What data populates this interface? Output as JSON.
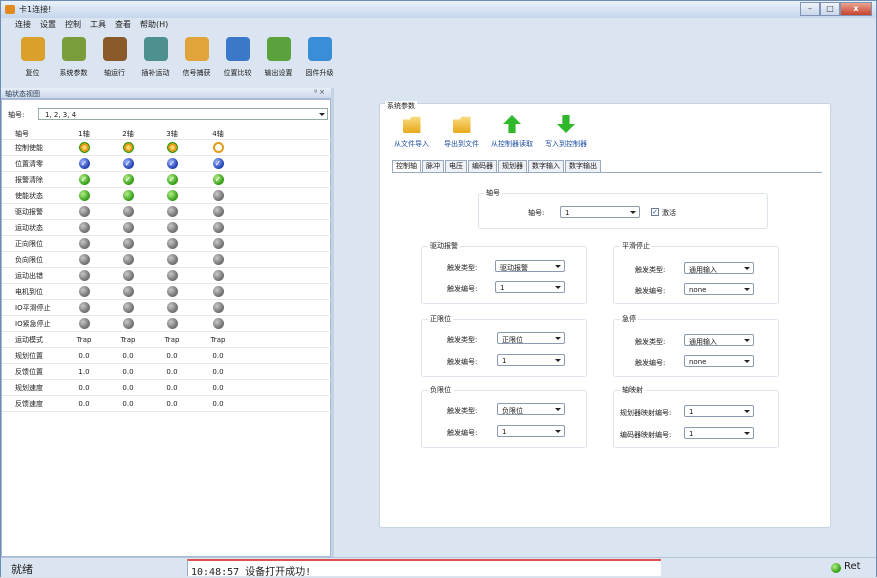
{
  "window": {
    "title": "卡1连接!",
    "buttons": {
      "minimize": "–",
      "maximize": "□",
      "close": "x"
    }
  },
  "menu": [
    "连接",
    "设置",
    "控制",
    "工具",
    "查看",
    "帮助(H)"
  ],
  "toolbar": [
    {
      "label": "复位",
      "icon": "reset-icon",
      "color": "#d9a12a"
    },
    {
      "label": "系统参数",
      "icon": "params-icon",
      "color": "#7a9c3b"
    },
    {
      "label": "轴运行",
      "icon": "wheel-icon",
      "color": "#8a5a2b"
    },
    {
      "label": "插补运动",
      "icon": "interp-icon",
      "color": "#4e8f8f"
    },
    {
      "label": "信号捕获",
      "icon": "map-pin-icon",
      "color": "#e0a43a"
    },
    {
      "label": "位置比较",
      "icon": "gear-globe-icon",
      "color": "#3c78c8"
    },
    {
      "label": "输出设置",
      "icon": "output-icon",
      "color": "#5aa23c"
    },
    {
      "label": "固件升级",
      "icon": "firmware-icon",
      "color": "#3a8ed8"
    }
  ],
  "left_panel": {
    "title": "轴状态视图",
    "header_buttons": "ᵍ ×",
    "axis_label": "轴号:",
    "axis_value": "1, 2, 3, 4",
    "columns": [
      "轴号",
      "1轴",
      "2轴",
      "3轴",
      "4轴"
    ],
    "led_rows": [
      {
        "label": "控制使能",
        "states": [
          "orange",
          "orange",
          "orange",
          "ring"
        ]
      },
      {
        "label": "位置清零",
        "states": [
          "blue",
          "blue",
          "blue",
          "blue"
        ]
      },
      {
        "label": "报警清除",
        "states": [
          "green-check",
          "green-check",
          "green-check",
          "green-check"
        ]
      },
      {
        "label": "使能状态",
        "states": [
          "green",
          "green",
          "green",
          "gray"
        ]
      },
      {
        "label": "驱动报警",
        "states": [
          "gray",
          "gray",
          "gray",
          "gray"
        ]
      },
      {
        "label": "运动状态",
        "states": [
          "gray",
          "gray",
          "gray",
          "gray"
        ]
      },
      {
        "label": "正向限位",
        "states": [
          "gray",
          "gray",
          "gray",
          "gray"
        ]
      },
      {
        "label": "负向限位",
        "states": [
          "gray",
          "gray",
          "gray",
          "gray"
        ]
      },
      {
        "label": "运动出错",
        "states": [
          "gray",
          "gray",
          "gray",
          "gray"
        ]
      },
      {
        "label": "电机到位",
        "states": [
          "gray",
          "gray",
          "gray",
          "gray"
        ]
      },
      {
        "label": "IO平滑停止",
        "states": [
          "gray",
          "gray",
          "gray",
          "gray"
        ]
      },
      {
        "label": "IO紧急停止",
        "states": [
          "gray",
          "gray",
          "gray",
          "gray"
        ]
      }
    ],
    "text_rows": [
      {
        "label": "运动模式",
        "values": [
          "Trap",
          "Trap",
          "Trap",
          "Trap"
        ]
      },
      {
        "label": "规划位置",
        "values": [
          "0.0",
          "0.0",
          "0.0",
          "0.0"
        ]
      },
      {
        "label": "反馈位置",
        "values": [
          "1.0",
          "0.0",
          "0.0",
          "0.0"
        ]
      },
      {
        "label": "规划速度",
        "values": [
          "0.0",
          "0.0",
          "0.0",
          "0.0"
        ]
      },
      {
        "label": "反馈速度",
        "values": [
          "0.0",
          "0.0",
          "0.0",
          "0.0"
        ]
      }
    ],
    "check_glyph": "✓"
  },
  "system_params": {
    "title": "系统参数",
    "actions": [
      "从文件导入",
      "导出到文件",
      "从控制器读取",
      "写入到控制器"
    ],
    "tabs": [
      "控制轴",
      "脉冲",
      "电压",
      "编码器",
      "规划器",
      "数字输入",
      "数字输出"
    ],
    "axis_group": {
      "title": "轴号",
      "label": "轴号:",
      "value": "1",
      "activate_label": "激活",
      "activate_glyph": "✓"
    },
    "drive_alarm": {
      "title": "驱动报警",
      "type_label": "触发类型:",
      "type_value": "驱动报警",
      "num_label": "触发编号:",
      "num_value": "1"
    },
    "smooth_stop": {
      "title": "平滑停止",
      "type_label": "触发类型:",
      "type_value": "通用输入",
      "num_label": "触发编号:",
      "num_value": "none"
    },
    "pos_limit": {
      "title": "正限位",
      "type_label": "触发类型:",
      "type_value": "正限位",
      "num_label": "触发编号:",
      "num_value": "1"
    },
    "e_stop": {
      "title": "急停",
      "type_label": "触发类型:",
      "type_value": "通用输入",
      "num_label": "触发编号:",
      "num_value": "none"
    },
    "neg_limit": {
      "title": "负限位",
      "type_label": "触发类型:",
      "type_value": "负限位",
      "num_label": "触发编号:",
      "num_value": "1"
    },
    "axis_map": {
      "title": "轴映射",
      "planner_label": "规划器映射编号:",
      "planner_value": "1",
      "encoder_label": "编码器映射编号:",
      "encoder_value": "1"
    }
  },
  "status": {
    "ready": "就绪",
    "message": "10:48:57 设备打开成功!",
    "ret": "Ret"
  }
}
